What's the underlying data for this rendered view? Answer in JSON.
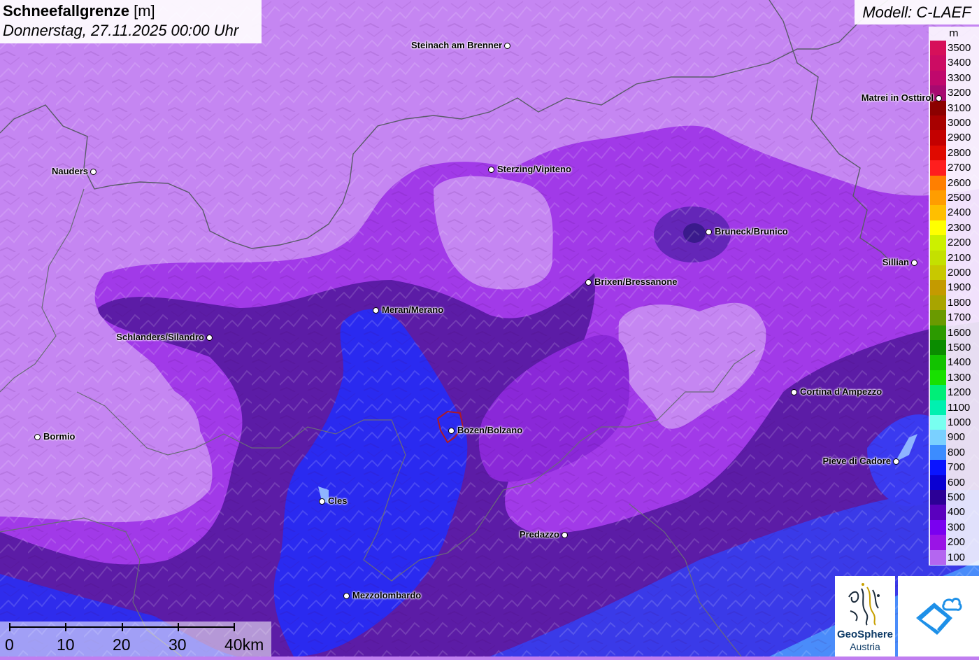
{
  "title": {
    "main": "Schneefallgrenze",
    "unit": "[m]",
    "date": "Donnerstag, 27.11.2025 00:00 Uhr"
  },
  "model": "Modell: C-LAEF",
  "legend": {
    "unit": "m",
    "entries": [
      {
        "label": "3500",
        "color": "#d6105a"
      },
      {
        "label": "3400",
        "color": "#cc0c63"
      },
      {
        "label": "3300",
        "color": "#c0086c"
      },
      {
        "label": "3200",
        "color": "#a60a70"
      },
      {
        "label": "3100",
        "color": "#8c0000"
      },
      {
        "label": "3000",
        "color": "#a80000"
      },
      {
        "label": "2900",
        "color": "#c40000"
      },
      {
        "label": "2800",
        "color": "#e00a00"
      },
      {
        "label": "2700",
        "color": "#ff1e1e"
      },
      {
        "label": "2600",
        "color": "#ff7f00"
      },
      {
        "label": "2500",
        "color": "#ff9d00"
      },
      {
        "label": "2400",
        "color": "#ffbf00"
      },
      {
        "label": "2300",
        "color": "#ffff00"
      },
      {
        "label": "2200",
        "color": "#ccf000"
      },
      {
        "label": "2100",
        "color": "#c4e000"
      },
      {
        "label": "2000",
        "color": "#c8c800"
      },
      {
        "label": "1900",
        "color": "#c49a00"
      },
      {
        "label": "1800",
        "color": "#a8a400"
      },
      {
        "label": "1700",
        "color": "#6a9a00"
      },
      {
        "label": "1600",
        "color": "#2c9a00"
      },
      {
        "label": "1500",
        "color": "#0a8c00"
      },
      {
        "label": "1400",
        "color": "#12c200"
      },
      {
        "label": "1300",
        "color": "#18e000"
      },
      {
        "label": "1200",
        "color": "#00ee78"
      },
      {
        "label": "1100",
        "color": "#00f0b0"
      },
      {
        "label": "1000",
        "color": "#78fff0"
      },
      {
        "label": "900",
        "color": "#7ad0ff"
      },
      {
        "label": "800",
        "color": "#3c8cff"
      },
      {
        "label": "700",
        "color": "#0a14ff"
      },
      {
        "label": "600",
        "color": "#0a00d2"
      },
      {
        "label": "500",
        "color": "#2c0096"
      },
      {
        "label": "400",
        "color": "#5a00be"
      },
      {
        "label": "300",
        "color": "#7a00f0"
      },
      {
        "label": "200",
        "color": "#9a14e6"
      },
      {
        "label": "100",
        "color": "#b466f0"
      }
    ]
  },
  "cities": [
    {
      "name": "Steinach am Brenner",
      "side": "left"
    },
    {
      "name": "Nauders",
      "side": "left"
    },
    {
      "name": "Sterzing/Vipiteno",
      "side": "right"
    },
    {
      "name": "Matrei in Osttirol",
      "side": "left"
    },
    {
      "name": "Bruneck/Brunico",
      "side": "right"
    },
    {
      "name": "Sillian",
      "side": "left"
    },
    {
      "name": "Brixen/Bressanone",
      "side": "right"
    },
    {
      "name": "Meran/Merano",
      "side": "right"
    },
    {
      "name": "Schlanders/Silandro",
      "side": "left"
    },
    {
      "name": "Cortina d'Ampezzo",
      "side": "right"
    },
    {
      "name": "Bormio",
      "side": "right"
    },
    {
      "name": "Bozen/Bolzano",
      "side": "right"
    },
    {
      "name": "Pieve di Cadore",
      "side": "left"
    },
    {
      "name": "Cles",
      "side": "right"
    },
    {
      "name": "Predazzo",
      "side": "left"
    },
    {
      "name": "Mezzolombardo",
      "side": "right"
    }
  ],
  "scale": {
    "labels": [
      "0",
      "10",
      "20",
      "30",
      "40km"
    ]
  },
  "logos": {
    "geosphere_name": "GeoSphere",
    "geosphere_sub": "Austria"
  },
  "colors": {
    "base_light": "#c07ef0",
    "violet": "#9a2ae6",
    "dark": "#4a1a9a",
    "blue": "#2020ee",
    "light_blue": "#4c9cff"
  }
}
